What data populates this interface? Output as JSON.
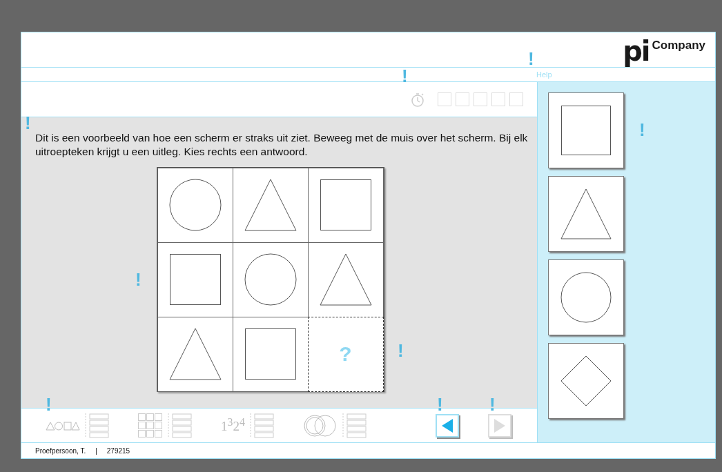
{
  "logo": {
    "mark": "pi",
    "text": "Company"
  },
  "help": {
    "label": "Help"
  },
  "instruction": "Dit is een voorbeeld van hoe een scherm er straks uit ziet. Beweeg met de muis over het scherm. Bij elk uitroepteken krijgt u een uitleg. Kies rechts een antwoord.",
  "grid": [
    {
      "kind": "circle"
    },
    {
      "kind": "triangle"
    },
    {
      "kind": "square"
    },
    {
      "kind": "square"
    },
    {
      "kind": "circle"
    },
    {
      "kind": "triangle"
    },
    {
      "kind": "triangle"
    },
    {
      "kind": "square"
    },
    {
      "kind": "question",
      "text": "?"
    }
  ],
  "answers": [
    {
      "kind": "square",
      "selected": false
    },
    {
      "kind": "triangle",
      "selected": false
    },
    {
      "kind": "circle",
      "selected": false
    },
    {
      "kind": "diamond",
      "selected": false
    }
  ],
  "toolbar": [
    {
      "kind": "shapes"
    },
    {
      "kind": "grid"
    },
    {
      "kind": "numbers",
      "text": "1$^{3}$2$^{4}$"
    },
    {
      "kind": "rings"
    }
  ],
  "nav": [
    {
      "kind": "prev",
      "disabled": false
    },
    {
      "kind": "next",
      "disabled": true
    }
  ],
  "hint_marks": [
    "!",
    "!",
    "!",
    "!",
    "!",
    "!",
    "!",
    "!",
    "!"
  ],
  "status": {
    "name": "Proefpersoon, T.",
    "separator": "|",
    "id": "279215"
  }
}
